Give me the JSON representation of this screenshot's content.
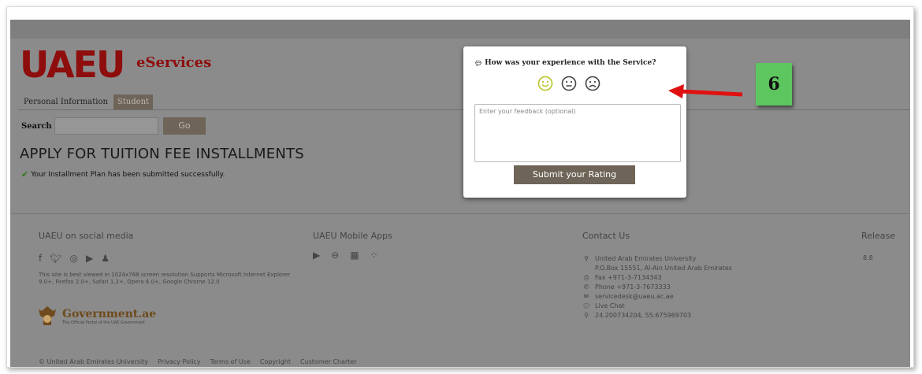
{
  "header": {
    "logo": "UAEU",
    "product": "eServices"
  },
  "tabs": [
    {
      "label": "Personal Information"
    },
    {
      "label": "Student"
    }
  ],
  "search": {
    "label": "Search",
    "value": "",
    "go_label": "Go"
  },
  "main": {
    "heading": "APPLY FOR TUITION FEE INSTALLMENTS",
    "success_message": "Your Installment Plan has been submitted successfully."
  },
  "footer": {
    "social_heading": "UAEU on social media",
    "social_icons": [
      "facebook-icon",
      "twitter-icon",
      "instagram-icon",
      "youtube-icon",
      "snapchat-icon"
    ],
    "browser_note": "This site is best viewed in 1024x768 screen resolution Supports Microsoft Internet Explorer 9.0+, Firefox 2.0+, Safari 1.2+, Opera 6.0+, Google Chrome 12.0",
    "gov_title": "Government.ae",
    "gov_subtitle": "The Official Portal of the UAE Government",
    "apps_heading": "UAEU Mobile Apps",
    "app_icons": [
      "google-play-icon",
      "apple-icon",
      "windows-icon",
      "blackberry-icon"
    ],
    "contact_heading": "Contact Us",
    "contact": {
      "address1": "United Arab Emirates University",
      "address2": "P.O.Box 15551, Al-Ain United Arab Emirates",
      "fax": "Fax +971-3-7134343",
      "phone": "Phone +971-3-7673333",
      "email": "servicedesk@uaeu.ac.ae",
      "chat": "Live Chat",
      "coords": "24.200734204, 55.675969703"
    },
    "release_heading": "Release",
    "release_value": "8.8",
    "bottom_links": [
      "© United Arab Emirates University",
      "Privacy Policy",
      "Terms of Use",
      "Copyright",
      "Customer Charter"
    ]
  },
  "feedback": {
    "question": "How was your experience with the Service?",
    "placeholder": "Enter your feedback (optional)",
    "submit_label": "Submit your Rating"
  },
  "annotation": {
    "number": "6"
  },
  "colors": {
    "brand_red": "#8e0d0d",
    "button_brown": "#6e6558",
    "badge_green": "#5ec65e",
    "arrow_red": "#e01010"
  }
}
